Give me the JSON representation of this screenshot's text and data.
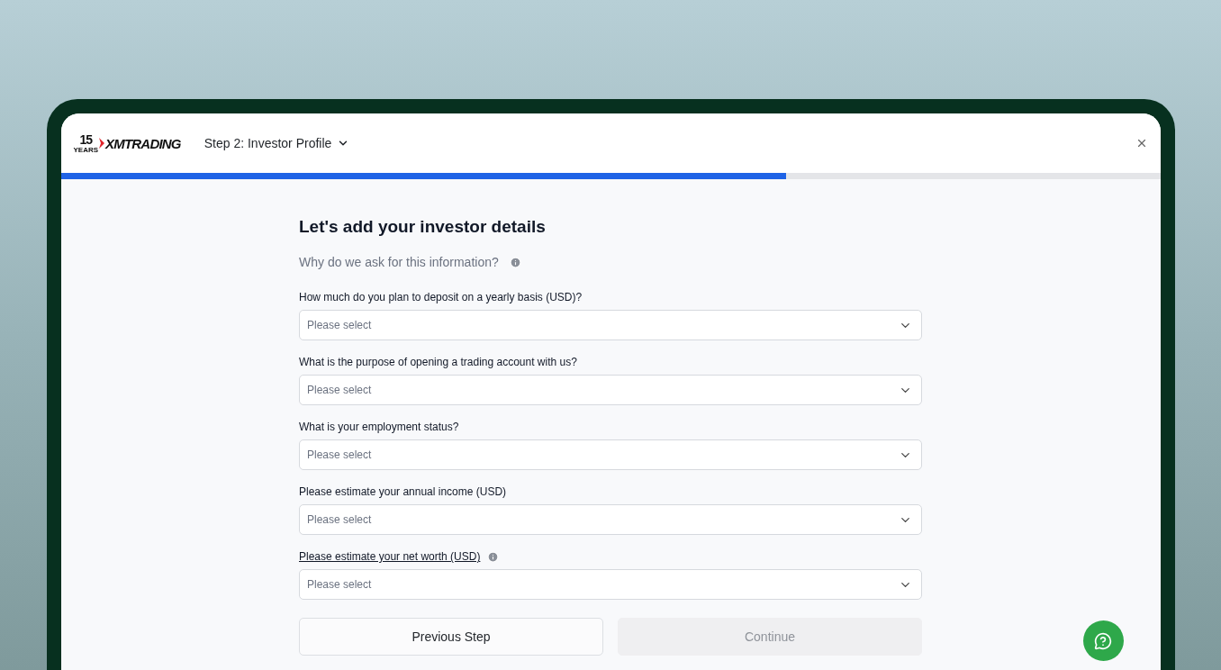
{
  "logo": {
    "number": "15",
    "years": "YEARS",
    "brand": "XMTRADING"
  },
  "step": {
    "label": "Step 2: Investor Profile"
  },
  "progress": {
    "level": 0.66
  },
  "form": {
    "title": "Let's add your investor details",
    "why": "Why do we ask for this information?",
    "fields": [
      {
        "label": "How much do you plan to deposit on a yearly basis (USD)?",
        "placeholder": "Please select",
        "info": false
      },
      {
        "label": "What is the purpose of opening a trading account with us?",
        "placeholder": "Please select",
        "info": false
      },
      {
        "label": "What is your employment status?",
        "placeholder": "Please select",
        "info": false
      },
      {
        "label": "Please estimate your annual income (USD)",
        "placeholder": "Please select",
        "info": false
      },
      {
        "label": "Please estimate your net worth (USD)",
        "placeholder": "Please select",
        "info": true
      }
    ],
    "buttons": [
      {
        "label": "Previous Step",
        "disabled": false
      },
      {
        "label": "Continue",
        "disabled": true
      }
    ]
  }
}
